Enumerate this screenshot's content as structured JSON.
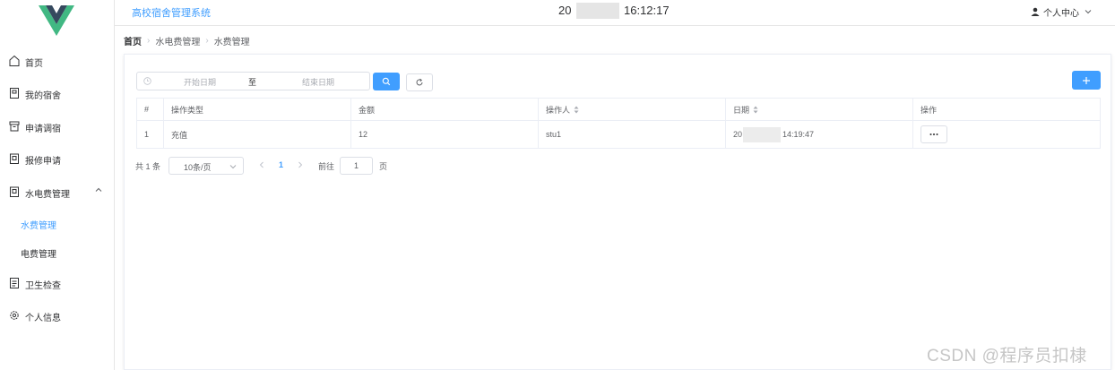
{
  "header": {
    "app_title": "高校宿舍管理系统",
    "clock_prefix": "20",
    "clock_time": "16:12:17",
    "user_menu_label": "个人中心"
  },
  "sidebar": {
    "items": [
      {
        "label": "首页",
        "icon": "home-icon"
      },
      {
        "label": "我的宿舍",
        "icon": "building-icon"
      },
      {
        "label": "申请调宿",
        "icon": "box-icon"
      },
      {
        "label": "报修申请",
        "icon": "clipboard-icon"
      },
      {
        "label": "水电费管理",
        "icon": "utility-icon",
        "expanded": true,
        "children": [
          {
            "label": "水费管理",
            "active": true
          },
          {
            "label": "电费管理",
            "active": false
          }
        ]
      },
      {
        "label": "卫生检查",
        "icon": "document-icon"
      },
      {
        "label": "个人信息",
        "icon": "gear-icon"
      }
    ]
  },
  "breadcrumb": [
    "首页",
    "水电费管理",
    "水费管理"
  ],
  "filters": {
    "start_placeholder": "开始日期",
    "range_separator": "至",
    "end_placeholder": "结束日期"
  },
  "table": {
    "columns": [
      "#",
      "操作类型",
      "金额",
      "操作人",
      "日期",
      "操作"
    ],
    "rows": [
      {
        "index": "1",
        "type": "充值",
        "amount": "12",
        "operator": "stu1",
        "date_prefix": "20",
        "date_time": "14:19:47"
      }
    ]
  },
  "pagination": {
    "total_label": "共 1 条",
    "page_size_label": "10条/页",
    "current_page": "1",
    "goto_label": "前往",
    "goto_value": "1",
    "page_unit": "页"
  },
  "watermark": "CSDN @程序员扣棣",
  "colors": {
    "primary": "#409eff",
    "logo_green": "#41b883",
    "logo_dark": "#35495e",
    "border": "#ebeef5"
  }
}
